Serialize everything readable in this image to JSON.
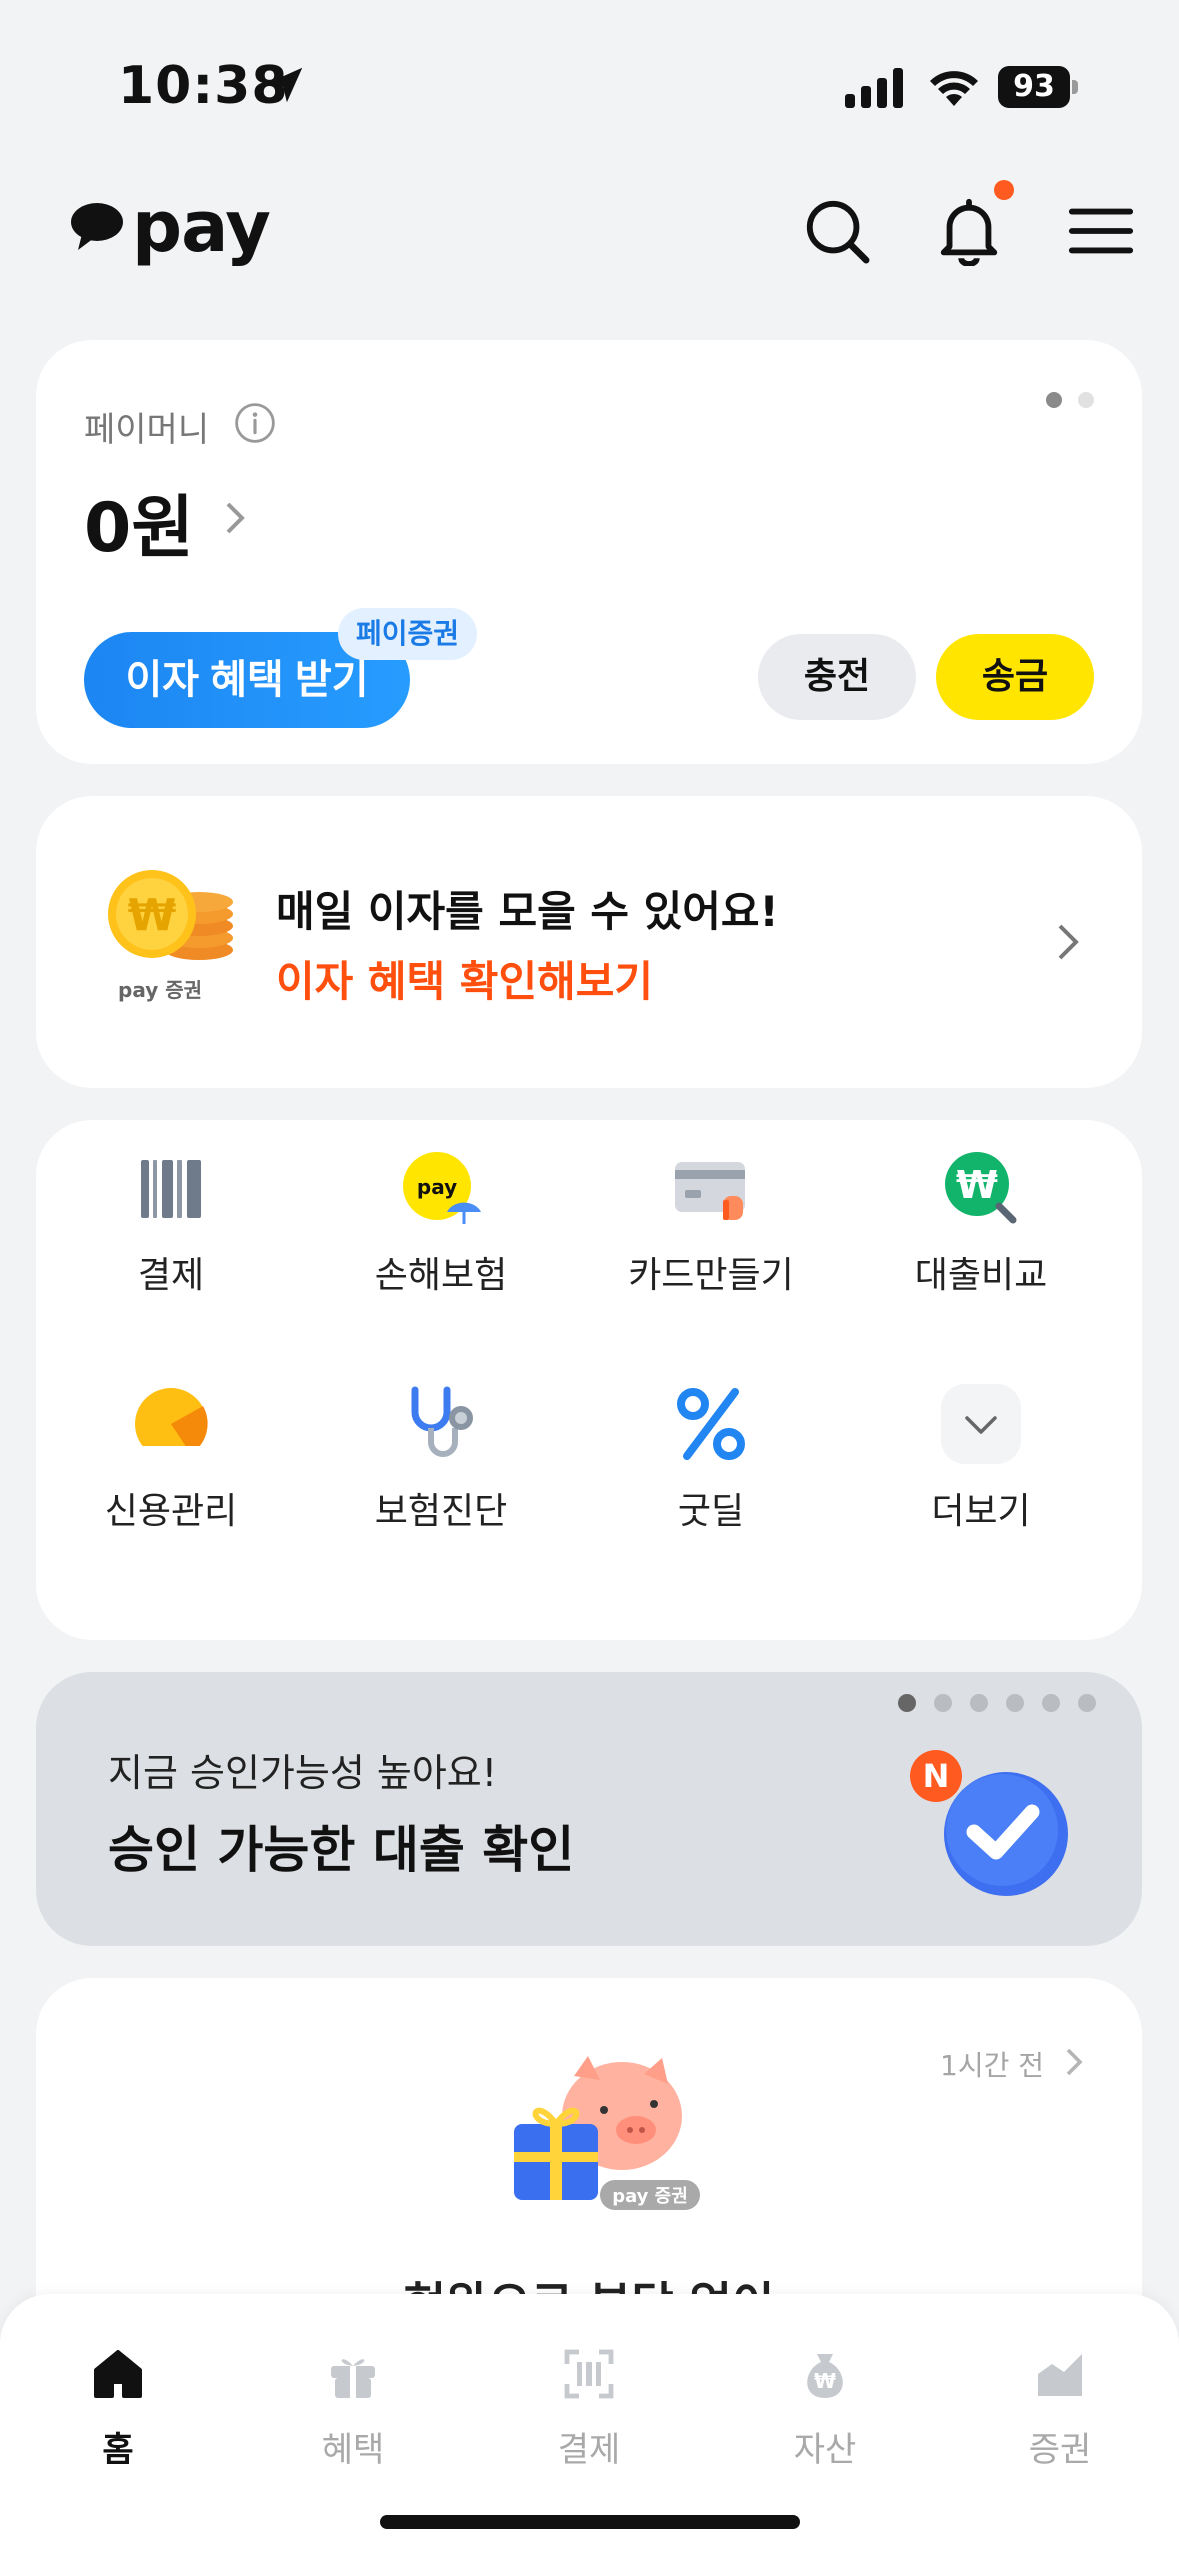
{
  "status_bar": {
    "time": "10:38",
    "battery": "93"
  },
  "header": {
    "logo_text": "pay"
  },
  "pay_money": {
    "label": "페이머니",
    "amount": "0원",
    "interest_button": "이자 혜택 받기",
    "badge": "페이증권",
    "charge_button": "충전",
    "send_button": "송금"
  },
  "promo": {
    "title": "매일 이자를 모을 수 있어요!",
    "subtitle": "이자 혜택 확인해보기",
    "coin_caption": "pay 증권"
  },
  "menu": {
    "items": [
      {
        "label": "결제",
        "icon": "barcode-icon"
      },
      {
        "label": "손해보험",
        "icon": "insurance-umbrella-icon"
      },
      {
        "label": "카드만들기",
        "icon": "card-icon"
      },
      {
        "label": "대출비교",
        "icon": "won-search-icon"
      },
      {
        "label": "신용관리",
        "icon": "credit-gauge-icon"
      },
      {
        "label": "보험진단",
        "icon": "stethoscope-icon"
      },
      {
        "label": "굿딜",
        "icon": "percent-icon"
      },
      {
        "label": "더보기",
        "icon": "chevron-down-icon"
      }
    ]
  },
  "banner": {
    "subtitle": "지금 승인가능성 높아요!",
    "title": "승인 가능한 대출 확인",
    "badge": "N"
  },
  "feed": {
    "time": "1시간 전",
    "art_caption": "pay 증권",
    "title": "현완으로 부담 없이"
  },
  "bottom_nav": {
    "items": [
      {
        "label": "홈",
        "icon": "home-icon",
        "active": true
      },
      {
        "label": "혜택",
        "icon": "gift-icon",
        "active": false
      },
      {
        "label": "결제",
        "icon": "barcode-scan-icon",
        "active": false
      },
      {
        "label": "자산",
        "icon": "money-bag-icon",
        "active": false
      },
      {
        "label": "증권",
        "icon": "stock-chart-icon",
        "active": false
      }
    ]
  },
  "colors": {
    "accent_yellow": "#ffe500",
    "accent_blue": "#1c86f2",
    "accent_orange": "#ff4f0e"
  }
}
